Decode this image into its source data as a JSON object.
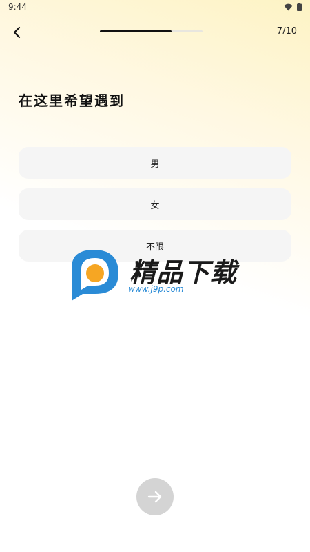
{
  "status_bar": {
    "time": "9:44",
    "icons": [
      "wifi-icon",
      "battery-icon"
    ]
  },
  "header": {
    "back_icon": "chevron-left-icon",
    "progress": 0.7,
    "step_counter": "7/10"
  },
  "title": "在这里希望遇到",
  "options": [
    {
      "label": "男"
    },
    {
      "label": "女"
    },
    {
      "label": "不限"
    }
  ],
  "watermark": {
    "text": "精品下载",
    "url": "www.j9p.com"
  },
  "next_button": {
    "icon": "arrow-right-icon"
  },
  "colors": {
    "progress_fill": "#111111",
    "option_bg": "#f5f5f5",
    "next_button_bg": "#d4d4d4",
    "watermark_blue": "#2a8bd6",
    "watermark_orange": "#f6a623"
  }
}
